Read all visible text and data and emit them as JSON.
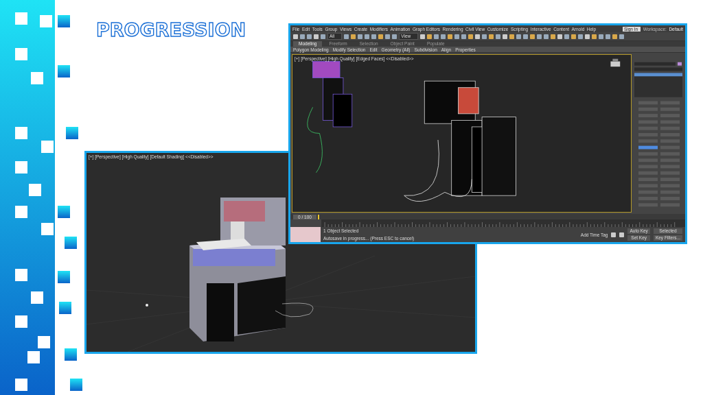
{
  "slide": {
    "title": "PROGRESSION"
  },
  "render_window": {
    "viewport_label": "[+] [Perspective] [High Quality] [Default Shading] <<Disabled>>"
  },
  "editor_window": {
    "menu": [
      "File",
      "Edit",
      "Tools",
      "Group",
      "Views",
      "Create",
      "Modifiers",
      "Animation",
      "Graph Editors",
      "Rendering",
      "Civil View",
      "Customize",
      "Scripting",
      "Interactive",
      "Content",
      "Arnold",
      "Help"
    ],
    "sign_in": "Sign In",
    "workspace_label": "Workspace:",
    "workspace": "Default",
    "toolbar_dropdowns": [
      "All",
      "View"
    ],
    "ribbon_tabs": [
      {
        "label": "Modeling",
        "selected": true
      },
      {
        "label": "Freeform",
        "selected": false
      },
      {
        "label": "Selection",
        "selected": false
      },
      {
        "label": "Object Paint",
        "selected": false
      },
      {
        "label": "Populate",
        "selected": false
      }
    ],
    "ribbon_items": [
      "Polygon Modeling",
      "Modify Selection",
      "Edit",
      "Geometry (All)",
      "Subdivision",
      "Align",
      "Properties"
    ],
    "viewport_label": "[+] [Perspective] [High Quality] [Edged Faces] <<Disabled>>",
    "timeline": {
      "range": "0 / 100"
    },
    "status": [
      "1 Object Selected",
      "Autosave in progress... (Press ESC to cancel)"
    ],
    "add_time_tag": "Add Time Tag",
    "auto_key": "Auto Key",
    "key_mode": "Selected",
    "set_key": "Set Key",
    "key_filters": "Key Filters..."
  }
}
